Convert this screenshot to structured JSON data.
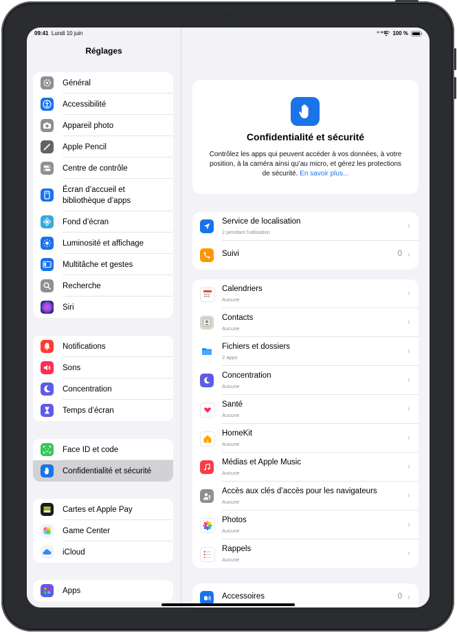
{
  "status": {
    "time": "09:41",
    "date": "Lundi 10 juin",
    "battery": "100 %"
  },
  "sidebar": {
    "title": "Réglages",
    "groups": [
      {
        "items": [
          {
            "label": "Général",
            "icon": "gear-icon",
            "color": "#8e8e93"
          },
          {
            "label": "Accessibilité",
            "icon": "accessibility-icon",
            "color": "#1a73e8"
          },
          {
            "label": "Appareil photo",
            "icon": "camera-icon",
            "color": "#8e8e93"
          },
          {
            "label": "Apple Pencil",
            "icon": "pencil-icon",
            "color": "#636366"
          },
          {
            "label": "Centre de contrôle",
            "icon": "toggles-icon",
            "color": "#8e8e93"
          },
          {
            "label": "Écran d’accueil et bibliothèque d’apps",
            "icon": "home-screen-icon",
            "color": "#1a73e8"
          },
          {
            "label": "Fond d’écran",
            "icon": "wallpaper-icon",
            "color": "#34aadc"
          },
          {
            "label": "Luminosité et affichage",
            "icon": "brightness-icon",
            "color": "#1a73e8"
          },
          {
            "label": "Multitâche et gestes",
            "icon": "multitasking-icon",
            "color": "#1a73e8"
          },
          {
            "label": "Recherche",
            "icon": "search-icon",
            "color": "#8e8e93"
          },
          {
            "label": "Siri",
            "icon": "siri-icon",
            "color": "#2b2b45"
          }
        ]
      },
      {
        "items": [
          {
            "label": "Notifications",
            "icon": "bell-icon",
            "color": "#ff3b30"
          },
          {
            "label": "Sons",
            "icon": "speaker-icon",
            "color": "#ff2d55"
          },
          {
            "label": "Concentration",
            "icon": "moon-icon",
            "color": "#5e5ce6"
          },
          {
            "label": "Temps d’écran",
            "icon": "hourglass-icon",
            "color": "#5e5ce6"
          }
        ]
      },
      {
        "items": [
          {
            "label": "Face ID et code",
            "icon": "faceid-icon",
            "color": "#34c759"
          },
          {
            "label": "Confidentialité et sécurité",
            "icon": "hand-icon",
            "color": "#1a73e8",
            "selected": true
          }
        ]
      },
      {
        "items": [
          {
            "label": "Cartes et Apple Pay",
            "icon": "wallet-icon",
            "color": "#1c1c1e"
          },
          {
            "label": "Game Center",
            "icon": "game-center-icon",
            "color": "#f2f2f7"
          },
          {
            "label": "iCloud",
            "icon": "cloud-icon",
            "color": "#f2f2f7"
          }
        ]
      },
      {
        "items": [
          {
            "label": "Apps",
            "icon": "apps-icon",
            "color": "#5e5ce6"
          }
        ]
      }
    ]
  },
  "hero": {
    "title": "Confidentialité et sécurité",
    "description": "Contrôlez les apps qui peuvent accéder à vos données, à votre position, à la caméra ainsi qu’au micro, et gérez les protections de sécurité.",
    "link": "En savoir plus..."
  },
  "main": {
    "groups": [
      {
        "items": [
          {
            "title": "Service de localisation",
            "subtitle": "2 pendant l’utilisation",
            "value": "",
            "icon": "location-arrow-icon",
            "color": "#1a73e8"
          },
          {
            "title": "Suivi",
            "subtitle": "",
            "value": "0",
            "icon": "tracking-icon",
            "color": "#ff9500"
          }
        ]
      },
      {
        "items": [
          {
            "title": "Calendriers",
            "subtitle": "Aucune",
            "value": "",
            "icon": "calendar-icon",
            "color": "#ffffff"
          },
          {
            "title": "Contacts",
            "subtitle": "Aucune",
            "value": "",
            "icon": "contacts-icon",
            "color": "#d9d6cf"
          },
          {
            "title": "Fichiers et dossiers",
            "subtitle": "2 apps",
            "value": "",
            "icon": "folder-icon",
            "color": "#ffffff"
          },
          {
            "title": "Concentration",
            "subtitle": "Aucune",
            "value": "",
            "icon": "moon-icon",
            "color": "#5e5ce6"
          },
          {
            "title": "Santé",
            "subtitle": "Aucune",
            "value": "",
            "icon": "heart-icon",
            "color": "#ffffff"
          },
          {
            "title": "HomeKit",
            "subtitle": "Aucune",
            "value": "",
            "icon": "home-icon",
            "color": "#ffffff"
          },
          {
            "title": "Médias et Apple Music",
            "subtitle": "Aucune",
            "value": "",
            "icon": "music-icon",
            "color": "#fc3c44"
          },
          {
            "title": "Accès aux clés d’accès pour les navigateurs",
            "subtitle": "Aucune",
            "value": "",
            "icon": "passkey-icon",
            "color": "#8e8e93"
          },
          {
            "title": "Photos",
            "subtitle": "Aucune",
            "value": "",
            "icon": "photos-icon",
            "color": "#ffffff"
          },
          {
            "title": "Rappels",
            "subtitle": "Aucune",
            "value": "",
            "icon": "reminders-icon",
            "color": "#ffffff"
          }
        ]
      },
      {
        "items": [
          {
            "title": "Accessoires",
            "subtitle": "",
            "value": "0",
            "icon": "accessories-icon",
            "color": "#1a73e8"
          }
        ]
      }
    ]
  }
}
